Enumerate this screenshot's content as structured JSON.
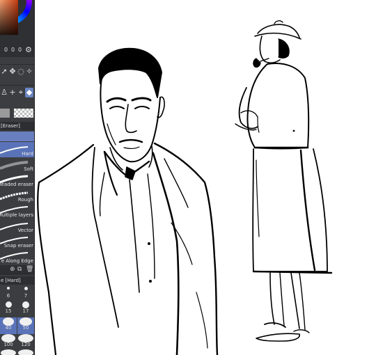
{
  "color_panel": {
    "rgb_values": [
      "0",
      "0",
      "0"
    ],
    "settings_icon": "gear-icon"
  },
  "tool_rows": [
    {
      "icons": [
        "cursor-icon",
        "move-icon",
        "lasso-icon",
        "magic-wand-icon"
      ]
    },
    {
      "icons": [
        "fill-icon",
        "add-point-icon",
        "eraser-tool-icon"
      ]
    }
  ],
  "eraser_header": "[Eraser]",
  "sub_tools": [
    {
      "label": "Hard"
    },
    {
      "label": "Soft"
    },
    {
      "label": "headed eraser"
    },
    {
      "label": "Rough"
    },
    {
      "label": "Multiple layers"
    },
    {
      "label": "Vector"
    },
    {
      "label": "Snap eraser"
    },
    {
      "label": "e Along Edge"
    }
  ],
  "size_header": "e [Hard]",
  "brush_sizes": [
    "6",
    "7",
    "15",
    "17",
    "40",
    "50",
    "100",
    "120"
  ],
  "canvas": {
    "subject_left": "man in suit portrait sketch",
    "subject_right": "deerstalker figure in long coat sketch"
  }
}
